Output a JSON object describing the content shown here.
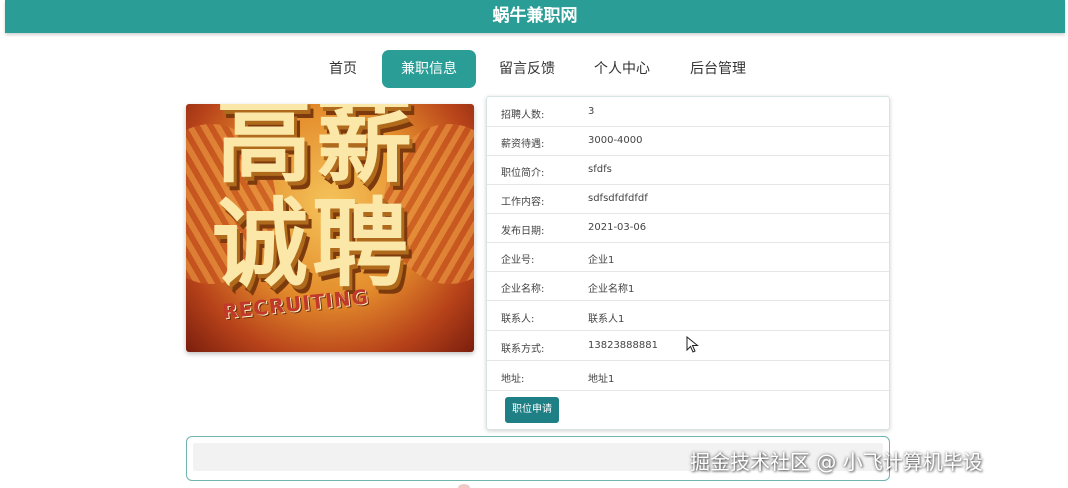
{
  "header": {
    "title": "蜗牛兼职网",
    "color": "#2a9d96"
  },
  "nav": {
    "items": [
      {
        "label": "首页",
        "active": false
      },
      {
        "label": "兼职信息",
        "active": true
      },
      {
        "label": "留言反馈",
        "active": false
      },
      {
        "label": "个人中心",
        "active": false
      },
      {
        "label": "后台管理",
        "active": false
      }
    ]
  },
  "poster": {
    "line1": "高薪",
    "line2": "诚聘",
    "english": "RECRUITING"
  },
  "job": {
    "rows": [
      {
        "label": "招聘人数:",
        "value": "3"
      },
      {
        "label": "薪资待遇:",
        "value": "3000-4000"
      },
      {
        "label": "职位简介:",
        "value": "sfdfs"
      },
      {
        "label": "工作内容:",
        "value": "sdfsdfdfdfdf"
      },
      {
        "label": "发布日期:",
        "value": "2021-03-06"
      },
      {
        "label": "企业号:",
        "value": "企业1"
      },
      {
        "label": "企业名称:",
        "value": "企业名称1"
      },
      {
        "label": "联系人:",
        "value": "联系人1"
      },
      {
        "label": "联系方式:",
        "value": "13823888881"
      },
      {
        "label": "地址:",
        "value": "地址1"
      }
    ],
    "apply_label": "职位申请"
  },
  "watermark": "掘金技术社区 @ 小飞计算机毕设"
}
